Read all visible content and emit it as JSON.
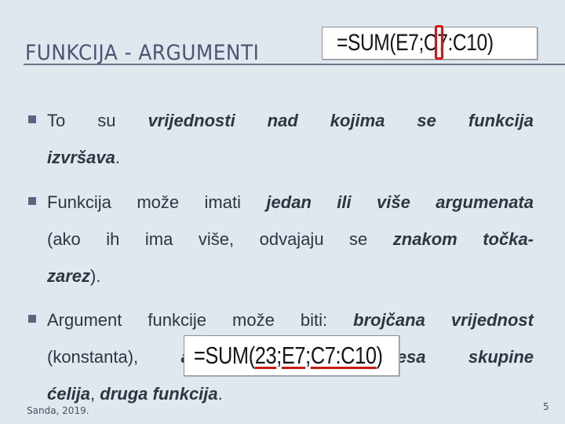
{
  "slide": {
    "title": "FUNKCIJA - ARGUMENTI",
    "page_number": "5",
    "footer": "Sanda, 2019."
  },
  "formula1": {
    "prefix": "=SUM(E7",
    "separator": ";",
    "suffix": "C7:C10)",
    "highlight_color": "#e01010"
  },
  "formula2": {
    "eq": "=SUM(",
    "arg1": "23",
    "sep1": ";",
    "arg2": "E7",
    "sep2": ";",
    "arg3": "C7:C10",
    "close": ")",
    "underline_color": "#c81818"
  },
  "bullets": [
    {
      "lines": [
        [
          {
            "t": "To su ",
            "b": false
          },
          {
            "t": "vrijednosti nad kojima se funkcija",
            "b": true
          }
        ],
        [
          {
            "t": "izvršava",
            "b": true
          },
          {
            "t": ".",
            "b": false
          }
        ]
      ]
    },
    {
      "lines": [
        [
          {
            "t": "Funkcija može imati ",
            "b": false
          },
          {
            "t": "jedan ili više argumenata",
            "b": true
          }
        ],
        [
          {
            "t": "(ako ih ima više, odvajaju se ",
            "b": false
          },
          {
            "t": "znakom točka-",
            "b": true
          }
        ],
        [
          {
            "t": "zarez",
            "b": true
          },
          {
            "t": ").",
            "b": false
          }
        ]
      ]
    },
    {
      "lines": [
        [
          {
            "t": "Argument funkcije može biti: ",
            "b": false
          },
          {
            "t": "brojčana vrijednost",
            "b": true
          }
        ],
        [
          {
            "t": "(konstanta), ",
            "b": false
          },
          {
            "t": "adresa ćelije, adresa skupine",
            "b": true
          }
        ],
        [
          {
            "t": "ćelija",
            "b": true
          },
          {
            "t": ", ",
            "b": false
          },
          {
            "t": "druga funkcija",
            "b": true
          },
          {
            "t": ".",
            "b": false
          }
        ]
      ]
    }
  ],
  "colors": {
    "background": "#dfe8ee",
    "title": "#4e5471",
    "bullet": "#5c6480"
  }
}
